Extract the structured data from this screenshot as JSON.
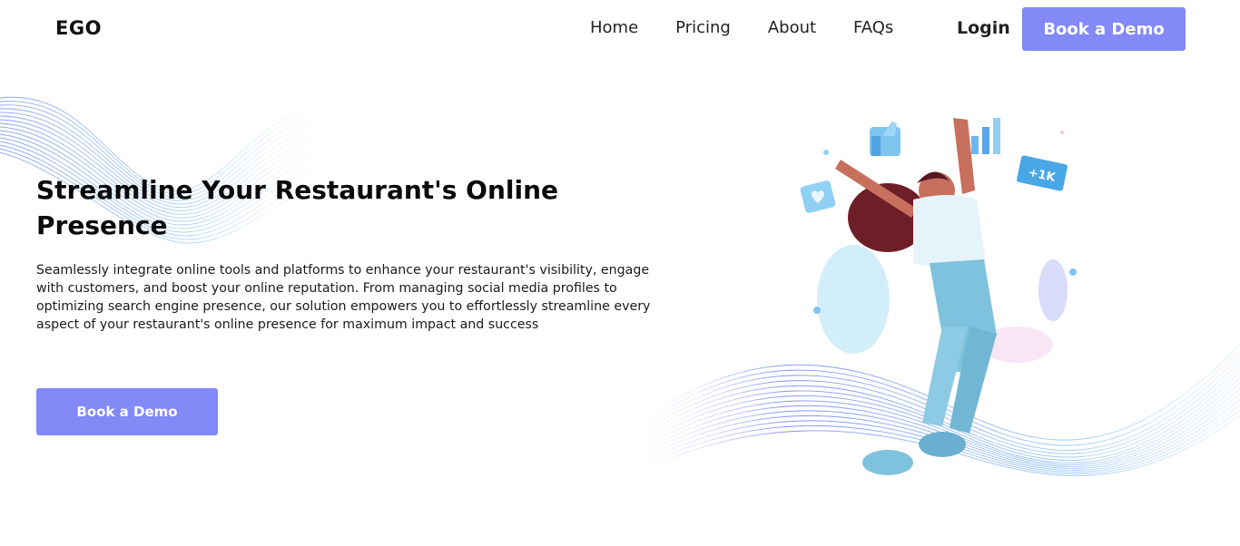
{
  "nav": {
    "logo": "EGO",
    "links": [
      "Home",
      "Pricing",
      "About",
      "FAQs"
    ],
    "login": "Login",
    "cta": "Book a Demo"
  },
  "hero": {
    "title": "Streamline Your Restaurant's Online Presence",
    "description": "Seamlessly integrate online tools and platforms to enhance your restaurant's visibility, engage with customers, and boost your online reputation. From managing social media profiles to optimizing search engine presence, our solution empowers you to effortlessly streamline every aspect of your restaurant's online presence for maximum impact and success",
    "cta": "Book a Demo"
  },
  "illustration": {
    "badge": "+1K",
    "icons": [
      "thumbs-up-icon",
      "bar-chart-icon",
      "heart-icon"
    ]
  },
  "colors": {
    "accent": "#8389f6",
    "wave": "#7f9ef0"
  }
}
